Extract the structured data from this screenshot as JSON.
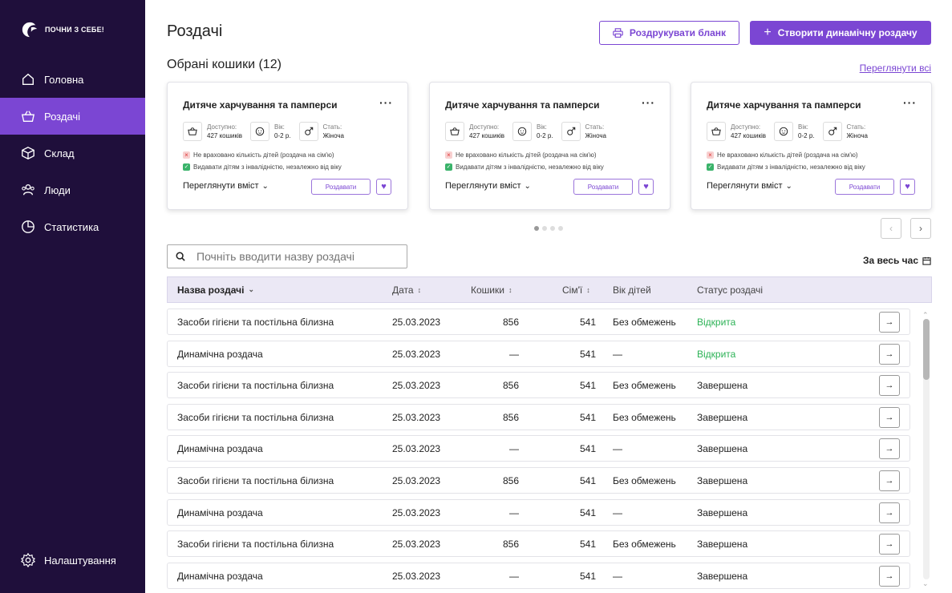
{
  "brand": {
    "logo_text": "ПОЧНИ З СЕБЕ!"
  },
  "sidebar": {
    "items": [
      {
        "label": "Головна",
        "icon": "home-icon",
        "active": false
      },
      {
        "label": "Роздачі",
        "icon": "basket-icon",
        "active": true
      },
      {
        "label": "Склад",
        "icon": "box-icon",
        "active": false
      },
      {
        "label": "Люди",
        "icon": "people-icon",
        "active": false
      },
      {
        "label": "Статистика",
        "icon": "chart-icon",
        "active": false
      }
    ],
    "settings_label": "Налаштування"
  },
  "header": {
    "title": "Роздачі",
    "print_label": "Роздрукувати бланк",
    "create_label": "Створити динамічну роздачу"
  },
  "featured": {
    "title": "Обрані кошики (12)",
    "view_all": "Переглянути всі",
    "cards": [
      {
        "title": "Дитяче харчування та памперси",
        "menu": "···",
        "available_label": "Доступно:",
        "available_value": "427 кошиків",
        "age_label": "Вік:",
        "age_value": "0-2 р.",
        "sex_label": "Стать:",
        "sex_value": "Жіноча",
        "rule_no": "Не враховано кількість дітей (роздача на сім'ю)",
        "rule_yes": "Видавати дітям з інвалідністю, незалежно від віку",
        "view_label": "Переглянути вміст",
        "give_label": "Роздавати"
      },
      {
        "title": "Дитяче харчування та памперси",
        "menu": "···",
        "available_label": "Доступно:",
        "available_value": "427 кошиків",
        "age_label": "Вік:",
        "age_value": "0-2 р.",
        "sex_label": "Стать:",
        "sex_value": "Жіноча",
        "rule_no": "Не враховано кількість дітей (роздача на сім'ю)",
        "rule_yes": "Видавати дітям з інвалідністю, незалежно від віку",
        "view_label": "Переглянути вміст",
        "give_label": "Роздавати"
      },
      {
        "title": "Дитяче харчування та памперси",
        "menu": "···",
        "available_label": "Доступно:",
        "available_value": "427 кошиків",
        "age_label": "Вік:",
        "age_value": "0-2 р.",
        "sex_label": "Стать:",
        "sex_value": "Жіноча",
        "rule_no": "Не враховано кількість дітей (роздача на сім'ю)",
        "rule_yes": "Видавати дітям з інвалідністю, незалежно від віку",
        "view_label": "Переглянути вміст",
        "give_label": "Роздавати"
      }
    ],
    "carousel_page": 1,
    "carousel_pages": 4
  },
  "search": {
    "placeholder": "Почніть вводити назву роздачі",
    "period_label": "За весь час"
  },
  "table": {
    "columns": [
      "Назва роздачі",
      "Дата",
      "Кошики",
      "Сім'ї",
      "Вік дітей",
      "Статус роздачі"
    ],
    "rows": [
      {
        "name": "Засоби гігієни та постільна білизна",
        "date": "25.03.2023",
        "baskets": "856",
        "families": "541",
        "age": "Без обмежень",
        "status": "Відкрита",
        "open": true
      },
      {
        "name": "Динамічна роздача",
        "date": "25.03.2023",
        "baskets": "—",
        "families": "541",
        "age": "—",
        "status": "Відкрита",
        "open": true
      },
      {
        "name": "Засоби гігієни та постільна білизна",
        "date": "25.03.2023",
        "baskets": "856",
        "families": "541",
        "age": "Без обмежень",
        "status": "Завершена",
        "open": false
      },
      {
        "name": "Засоби гігієни та постільна білизна",
        "date": "25.03.2023",
        "baskets": "856",
        "families": "541",
        "age": "Без обмежень",
        "status": "Завершена",
        "open": false
      },
      {
        "name": "Динамічна роздача",
        "date": "25.03.2023",
        "baskets": "—",
        "families": "541",
        "age": "—",
        "status": "Завершена",
        "open": false
      },
      {
        "name": "Засоби гігієни та постільна білизна",
        "date": "25.03.2023",
        "baskets": "856",
        "families": "541",
        "age": "Без обмежень",
        "status": "Завершена",
        "open": false
      },
      {
        "name": "Динамічна роздача",
        "date": "25.03.2023",
        "baskets": "—",
        "families": "541",
        "age": "—",
        "status": "Завершена",
        "open": false
      },
      {
        "name": "Засоби гігієни та постільна білизна",
        "date": "25.03.2023",
        "baskets": "856",
        "families": "541",
        "age": "Без обмежень",
        "status": "Завершена",
        "open": false
      },
      {
        "name": "Динамічна роздача",
        "date": "25.03.2023",
        "baskets": "—",
        "families": "541",
        "age": "—",
        "status": "Завершена",
        "open": false
      }
    ]
  },
  "colors": {
    "sidebar_bg": "#1f0f3b",
    "accent": "#7b46d3",
    "open_status": "#2bb255"
  }
}
